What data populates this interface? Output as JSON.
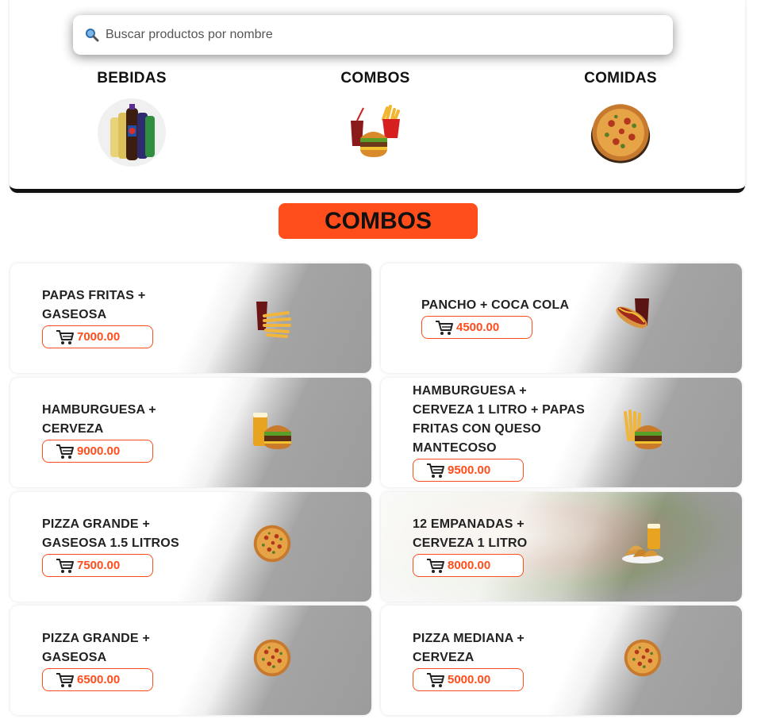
{
  "search": {
    "placeholder": "Buscar productos por nombre"
  },
  "categories": [
    {
      "label": "BEBIDAS",
      "icon": "soda-bottles-icon"
    },
    {
      "label": "COMBOS",
      "icon": "combo-meal-icon"
    },
    {
      "label": "COMIDAS",
      "icon": "pizza-icon"
    }
  ],
  "section": {
    "title": "COMBOS"
  },
  "products": [
    {
      "name": "PAPAS FRITAS + GASEOSA",
      "price": "7000.00",
      "icon": "fries-soda-icon"
    },
    {
      "name": "PANCHO + COCA COLA",
      "price": "4500.00",
      "icon": "hotdog-soda-icon"
    },
    {
      "name": "HAMBURGUESA + CERVEZA",
      "price": "9000.00",
      "icon": "burger-beer-icon"
    },
    {
      "name": "HAMBURGUESA + CERVEZA 1 LITRO + PAPAS FRITAS CON QUESO MANTECOSO",
      "price": "9500.00",
      "icon": "burger-fries-icon"
    },
    {
      "name": "PIZZA GRANDE + GASEOSA 1.5 LITROS",
      "price": "7500.00",
      "icon": "pizza-icon"
    },
    {
      "name": "12 EMPANADAS + CERVEZA 1 LITRO",
      "price": "8000.00",
      "icon": "empanadas-beer-icon"
    },
    {
      "name": "PIZZA GRANDE + GASEOSA",
      "price": "6500.00",
      "icon": "pizza-icon"
    },
    {
      "name": "PIZZA MEDIANA + CERVEZA",
      "price": "5000.00",
      "icon": "pizza-icon"
    }
  ],
  "colors": {
    "accent": "#ff4d1c",
    "text": "#222222",
    "panel_border": "#111111"
  }
}
